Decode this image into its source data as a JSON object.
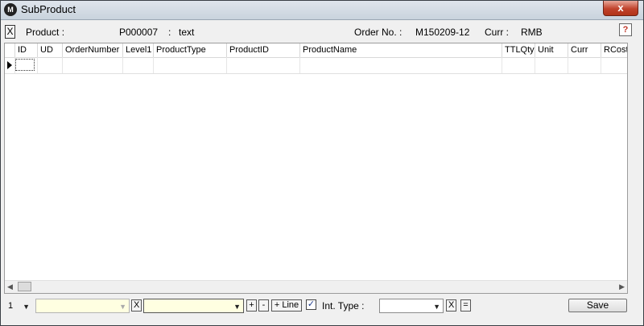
{
  "window": {
    "title": "SubProduct",
    "close_symbol": "x",
    "app_icon_text": "M"
  },
  "header": {
    "x_button": "X",
    "product_label": "Product :",
    "product_code": "P000007",
    "product_sep": ":",
    "product_text": "text",
    "order_label": "Order No. :",
    "order_value": "M150209-12",
    "curr_label": "Curr :",
    "curr_value": "RMB",
    "help_symbol": "?"
  },
  "grid": {
    "columns": [
      "ID",
      "UD",
      "OrderNumber",
      "Level1",
      "ProductType",
      "ProductID",
      "ProductName",
      "TTLQty",
      "Unit",
      "Curr",
      "RCost"
    ],
    "rows": [
      []
    ]
  },
  "bottom": {
    "page_value": "1",
    "x_label": "X",
    "plus": "+",
    "minus": "-",
    "add_line": "+ Line",
    "checkbox_checked": true,
    "check_mark": "✓",
    "int_type_label": "Int. Type :",
    "x2_label": "X",
    "equals_label": "=",
    "save_label": "Save"
  },
  "colors": {
    "input_yellow": "#ffffe1",
    "close_red": "#c0432c"
  }
}
